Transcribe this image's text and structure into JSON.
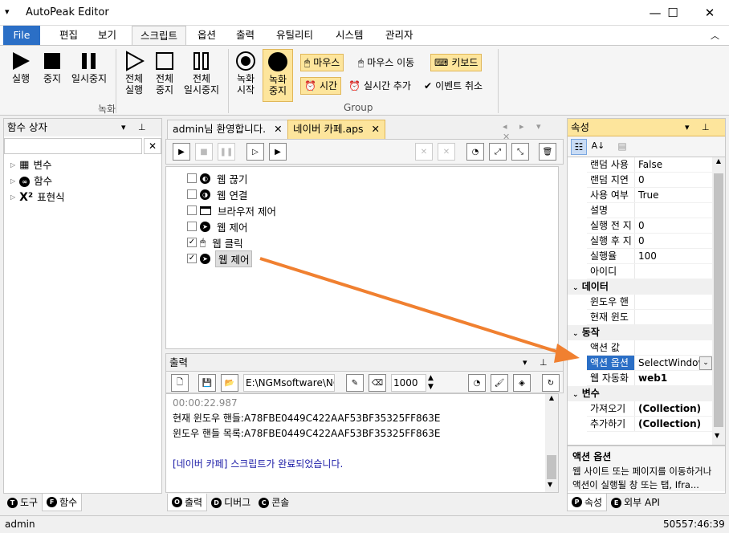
{
  "window": {
    "title": "AutoPeak Editor",
    "menu_icon": "▾",
    "minimize": "—",
    "maximize": "☐",
    "close": "✕"
  },
  "menu": {
    "tabs": [
      "File",
      "편집",
      "보기",
      "스크립트",
      "옵션",
      "출력",
      "유틸리티",
      "시스템",
      "관리자"
    ],
    "collapse_icon": "chevron-up-icon"
  },
  "ribbon": {
    "record_group": "녹화",
    "group_group": "Group",
    "buttons": [
      {
        "line1": "실행",
        "line2": "",
        "icon": "play-icon"
      },
      {
        "line1": "중지",
        "line2": "",
        "icon": "stop-icon"
      },
      {
        "line1": "일시중지",
        "line2": "",
        "icon": "pause-icon"
      },
      {
        "line1": "전체",
        "line2": "실행",
        "icon": "play-outline-icon"
      },
      {
        "line1": "전체",
        "line2": "중지",
        "icon": "stop-outline-icon"
      },
      {
        "line1": "전체",
        "line2": "일시중지",
        "icon": "pause-outline-icon"
      },
      {
        "line1": "녹화",
        "line2": "시작",
        "icon": "record-start-icon"
      },
      {
        "line1": "녹화",
        "line2": "중지",
        "icon": "record-stop-icon"
      }
    ],
    "small": {
      "mouse": "마우스",
      "mouse_move": "마우스 이동",
      "keyboard": "키보드",
      "time": "시간",
      "realtime_add": "실시간 추가",
      "event_cancel": "이벤트 취소"
    }
  },
  "left_panel": {
    "title": "함수 상자",
    "search_value": "",
    "items": [
      {
        "label": "변수",
        "icon": "variable-icon"
      },
      {
        "label": "함수",
        "icon": "function-icon"
      },
      {
        "label": "표현식",
        "icon": "expression-icon"
      }
    ],
    "tabs": [
      {
        "letter": "T",
        "label": "도구"
      },
      {
        "letter": "F",
        "label": "함수"
      }
    ]
  },
  "doc_tabs": [
    {
      "label": "admin님 환영합니다."
    },
    {
      "label": "네이버 카페.aps"
    }
  ],
  "editor_nodes": [
    {
      "label": "웹 끊기",
      "checked": false,
      "icon": "web-disconnect-icon"
    },
    {
      "label": "웹 연결",
      "checked": false,
      "icon": "web-connect-icon"
    },
    {
      "label": "브라우저 제어",
      "checked": false,
      "icon": "browser-icon"
    },
    {
      "label": "웹 제어",
      "checked": false,
      "icon": "web-control-icon"
    },
    {
      "label": "웹 클릭",
      "checked": true,
      "icon": "web-click-icon"
    },
    {
      "label": "웹 제어",
      "checked": true,
      "icon": "web-control-icon"
    }
  ],
  "output": {
    "title": "출력",
    "path_value": "E:\\NGMsoftware\\NG",
    "count_value": "1000",
    "lines": [
      {
        "text": "00:00:22.987",
        "color": "#888888"
      },
      {
        "text": "현재 윈도우 핸들:A78FBE0449C422AAF53BF35325FF863E",
        "color": "#000000"
      },
      {
        "text": "윈도우 핸들 목록:A78FBE0449C422AAF53BF35325FF863E",
        "color": "#000000"
      },
      {
        "text": "",
        "color": "#000000"
      },
      {
        "text": "[네이버 카페] 스크립트가 완료되었습니다.",
        "color": "#1a1aa6"
      }
    ],
    "tabs": [
      {
        "letter": "O",
        "label": "출력"
      },
      {
        "letter": "D",
        "label": "디버그"
      },
      {
        "letter": "C",
        "label": "콘솔"
      }
    ]
  },
  "props": {
    "title": "속성",
    "rows_top": [
      {
        "k": "랜덤 사용",
        "v": "False"
      },
      {
        "k": "랜덤 지연",
        "v": "0"
      },
      {
        "k": "사용 여부",
        "v": "True"
      },
      {
        "k": "설명",
        "v": ""
      },
      {
        "k": "실행 전 지",
        "v": "0"
      },
      {
        "k": "실행 후 지",
        "v": "0"
      },
      {
        "k": "실행율",
        "v": "100"
      },
      {
        "k": "아이디",
        "v": ""
      }
    ],
    "cat_data": "데이터",
    "rows_data": [
      {
        "k": "윈도우 핸",
        "v": ""
      },
      {
        "k": "현재 윈도",
        "v": ""
      }
    ],
    "cat_action": "동작",
    "rows_action": [
      {
        "k": "액션 값",
        "v": ""
      },
      {
        "k": "액션 옵션",
        "v": "SelectWindow"
      },
      {
        "k": "웹 자동화",
        "v": "web1"
      }
    ],
    "cat_var": "변수",
    "rows_var": [
      {
        "k": "가져오기",
        "v": "(Collection)"
      },
      {
        "k": "추가하기",
        "v": "(Collection)"
      }
    ],
    "desc_title": "액션 옵션",
    "desc_text": "웹 사이트 또는 페이지를 이동하거나 액션이 실행될 창 또는 탭, Ifra...",
    "tabs": [
      {
        "letter": "P",
        "label": "속성"
      },
      {
        "letter": "E",
        "label": "외부 API"
      }
    ]
  },
  "status": {
    "user": "admin",
    "time": "50557:46:39"
  },
  "colors": {
    "accent": "#2b6fc6",
    "highlight": "#fde59c",
    "arrow": "#f08030"
  }
}
